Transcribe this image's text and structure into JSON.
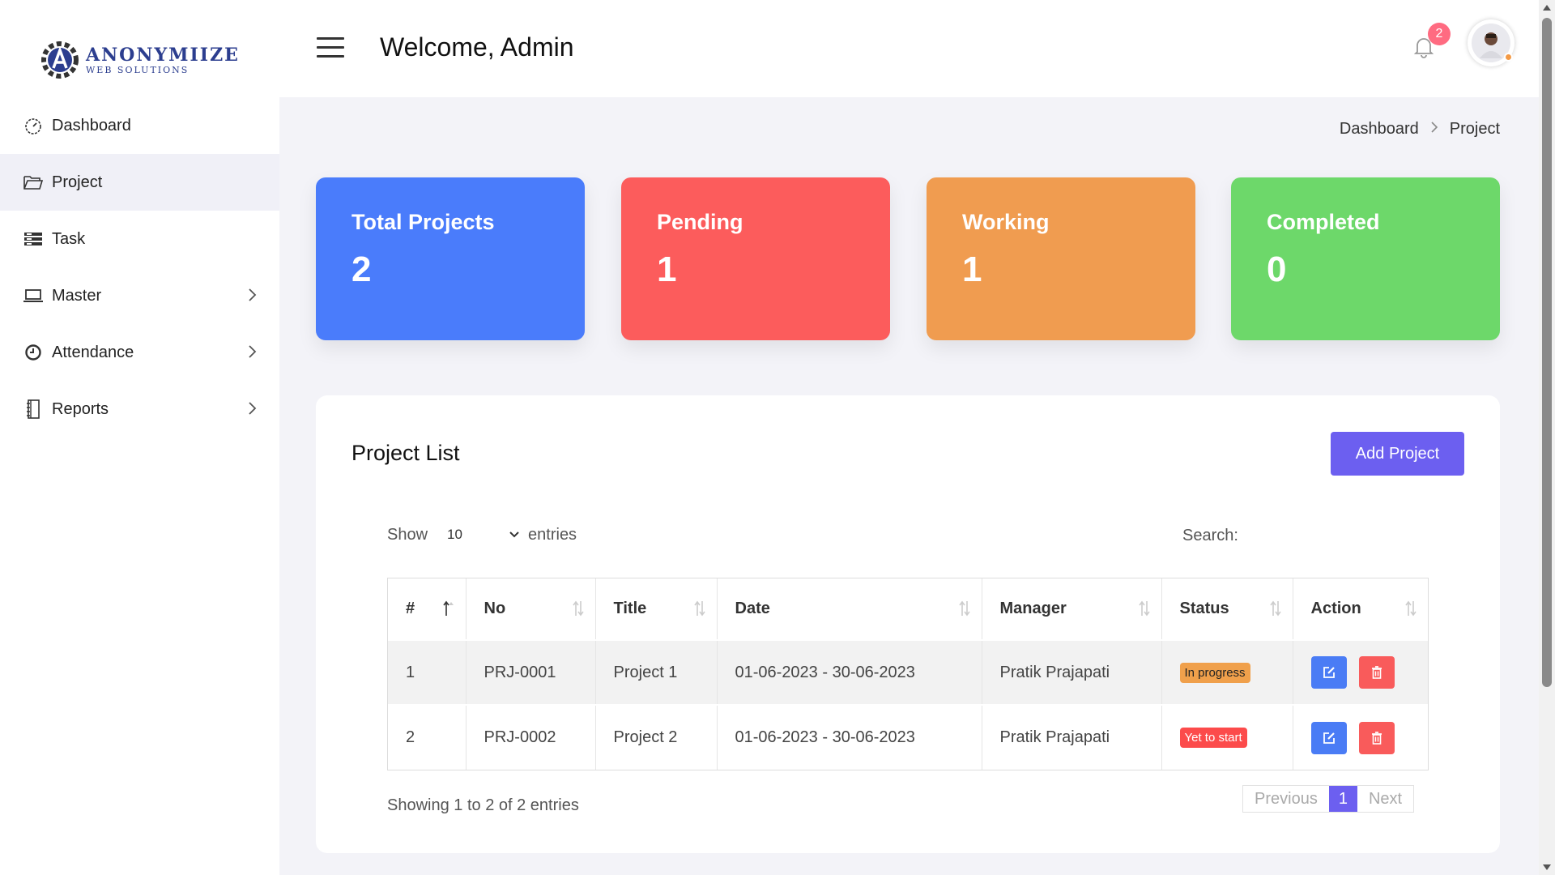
{
  "brand": {
    "name": "ANONYMIIZE",
    "sub": "WEB SOLUTIONS"
  },
  "sidebar": {
    "items": [
      {
        "label": "Dashboard",
        "icon": "gauge-icon",
        "active": false,
        "expandable": false
      },
      {
        "label": "Project",
        "icon": "folder-open-icon",
        "active": true,
        "expandable": false
      },
      {
        "label": "Task",
        "icon": "list-icon",
        "active": false,
        "expandable": false
      },
      {
        "label": "Master",
        "icon": "laptop-icon",
        "active": false,
        "expandable": true
      },
      {
        "label": "Attendance",
        "icon": "clock-icon",
        "active": false,
        "expandable": true
      },
      {
        "label": "Reports",
        "icon": "notebook-icon",
        "active": false,
        "expandable": true
      }
    ]
  },
  "header": {
    "welcome": "Welcome, Admin",
    "notifications_count": "2"
  },
  "breadcrumb": {
    "parent": "Dashboard",
    "current": "Project"
  },
  "stats": [
    {
      "label": "Total Projects",
      "value": "2",
      "color": "#4a7cfb"
    },
    {
      "label": "Pending",
      "value": "1",
      "color": "#fc5c5c"
    },
    {
      "label": "Working",
      "value": "1",
      "color": "#f09c50"
    },
    {
      "label": "Completed",
      "value": "0",
      "color": "#6dd86a"
    }
  ],
  "panel": {
    "title": "Project List",
    "add_button": "Add Project",
    "show_label": "Show",
    "entries_value": "10",
    "entries_label": "entries",
    "search_label": "Search:",
    "columns": [
      "#",
      "No",
      "Title",
      "Date",
      "Manager",
      "Status",
      "Action"
    ],
    "rows": [
      {
        "num": "1",
        "no": "PRJ-0001",
        "title": "Project 1",
        "date": "01-06-2023 - 30-06-2023",
        "manager": "Pratik Prajapati",
        "status": "In progress",
        "status_color": "#f0a04b"
      },
      {
        "num": "2",
        "no": "PRJ-0002",
        "title": "Project 2",
        "date": "01-06-2023 - 30-06-2023",
        "manager": "Pratik Prajapati",
        "status": "Yet to start",
        "status_color": "#fc4b4b"
      }
    ],
    "showing": "Showing 1 to 2 of 2 entries",
    "pager": {
      "prev": "Previous",
      "page": "1",
      "next": "Next"
    }
  },
  "colors": {
    "accent": "#6c5ff0",
    "edit": "#4a7cf5",
    "delete": "#f95b5b"
  }
}
